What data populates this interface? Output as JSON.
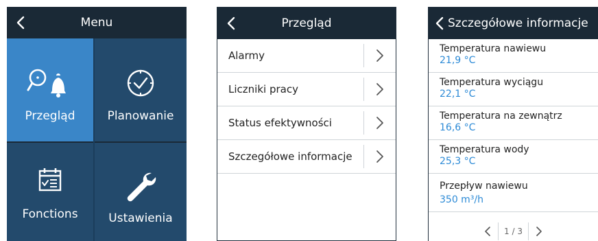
{
  "menu": {
    "title": "Menu",
    "tiles": [
      {
        "label": "Przegląd",
        "icon": "search-bell-icon"
      },
      {
        "label": "Planowanie",
        "icon": "clock-icon"
      },
      {
        "label": "Fonctions",
        "icon": "calendar-checklist-icon"
      },
      {
        "label": "Ustawienia",
        "icon": "wrench-icon"
      }
    ]
  },
  "overview": {
    "title": "Przegląd",
    "items": [
      {
        "label": "Alarmy"
      },
      {
        "label": "Liczniki pracy"
      },
      {
        "label": "Status efektywności"
      },
      {
        "label": "Szczegółowe informacje"
      }
    ]
  },
  "details": {
    "title": "Szczegółowe informacje",
    "items": [
      {
        "name": "Temperatura nawiewu",
        "value": "21,9 °C"
      },
      {
        "name": "Temperatura wyciągu",
        "value": "22,1 °C"
      },
      {
        "name": "Temperatura na zewnątrz",
        "value": "16,6 °C"
      },
      {
        "name": "Temperatura wody",
        "value": "25,3 °C"
      },
      {
        "name": "Przepływ nawiewu",
        "value": "350 m³/h"
      }
    ],
    "pager": "1 / 3"
  },
  "colors": {
    "header": "#1a2936",
    "tile_active": "#3a86c8",
    "tile": "#234a6c",
    "value_blue": "#2c8ad6"
  }
}
